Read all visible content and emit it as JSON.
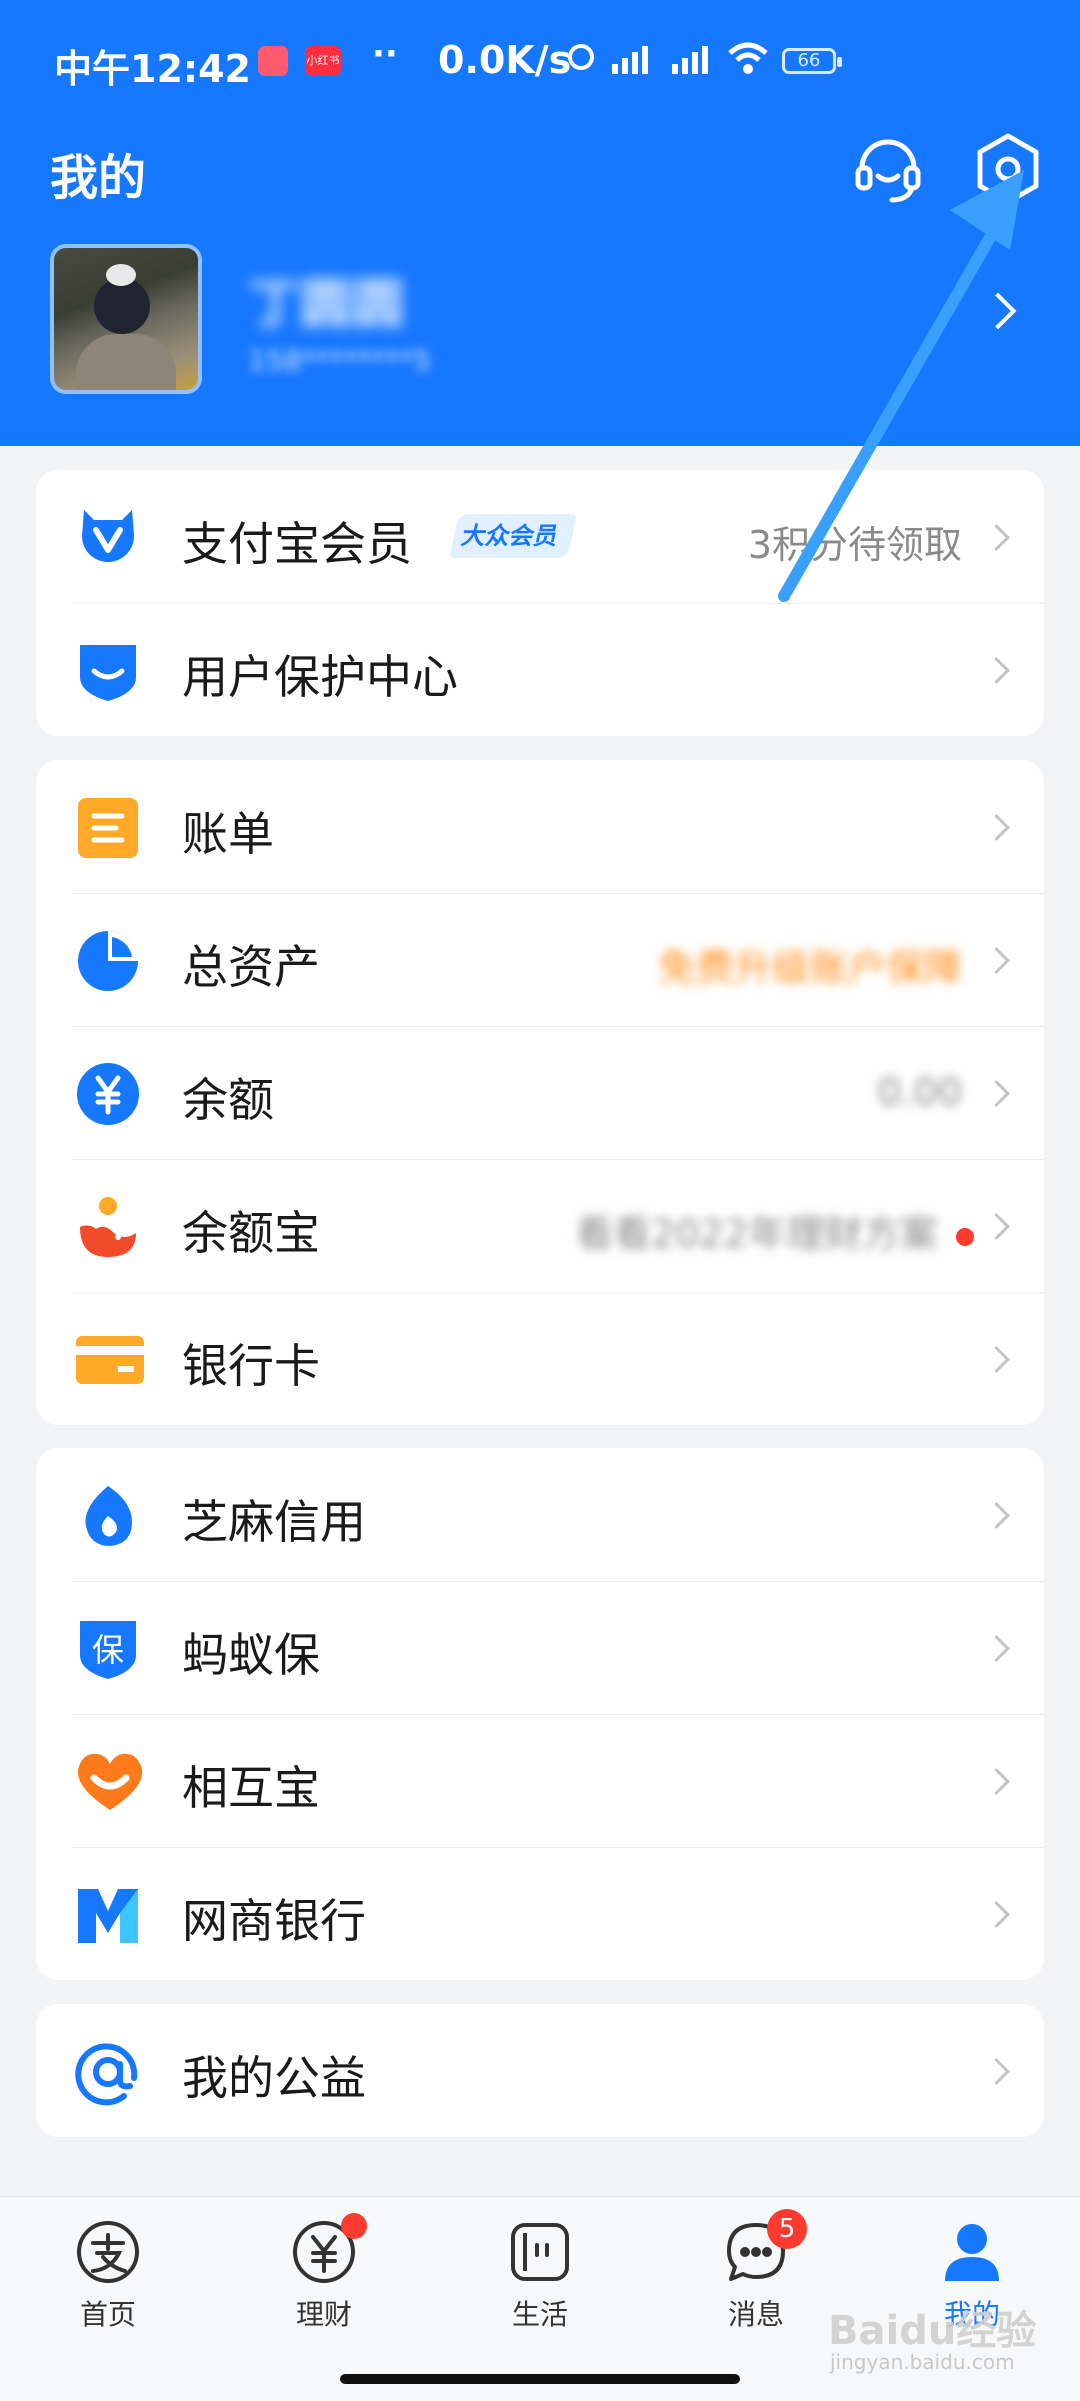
{
  "status_bar": {
    "time": "中午12:42",
    "app_badge_2": "小红书",
    "dots": "··",
    "net_speed": "0.0K/s",
    "battery": "66"
  },
  "header": {
    "title": "我的",
    "user_name": "丁圆圆",
    "user_sub": "158********5"
  },
  "section_1": [
    {
      "label": "支付宝会员",
      "badge": "大众会员",
      "right": "3积分待领取"
    },
    {
      "label": "用户保护中心",
      "right": ""
    }
  ],
  "section_2": [
    {
      "label": "账单",
      "right": ""
    },
    {
      "label": "总资产",
      "right": "免费升级账户保障"
    },
    {
      "label": "余额",
      "right": "0.00"
    },
    {
      "label": "余额宝",
      "right": "看看2022年理财方案"
    },
    {
      "label": "银行卡",
      "right": ""
    }
  ],
  "section_3": [
    {
      "label": "芝麻信用"
    },
    {
      "label": "蚂蚁保"
    },
    {
      "label": "相互宝"
    },
    {
      "label": "网商银行"
    }
  ],
  "section_4": [
    {
      "label": "我的公益"
    }
  ],
  "tabbar": {
    "items": [
      {
        "label": "首页",
        "icon": "alipay-home-icon"
      },
      {
        "label": "理财",
        "icon": "yuan-coin-icon"
      },
      {
        "label": "生活",
        "icon": "life-grid-icon"
      },
      {
        "label": "消息",
        "icon": "chat-bubble-icon",
        "badge": "5"
      },
      {
        "label": "我的",
        "icon": "person-icon"
      }
    ]
  },
  "watermark": {
    "text": "Baidu经验",
    "sub": "jingyan.baidu.com"
  },
  "colors": {
    "brand_blue": "#1677ff",
    "orange": "#ffa928",
    "red": "#ff3b30"
  }
}
